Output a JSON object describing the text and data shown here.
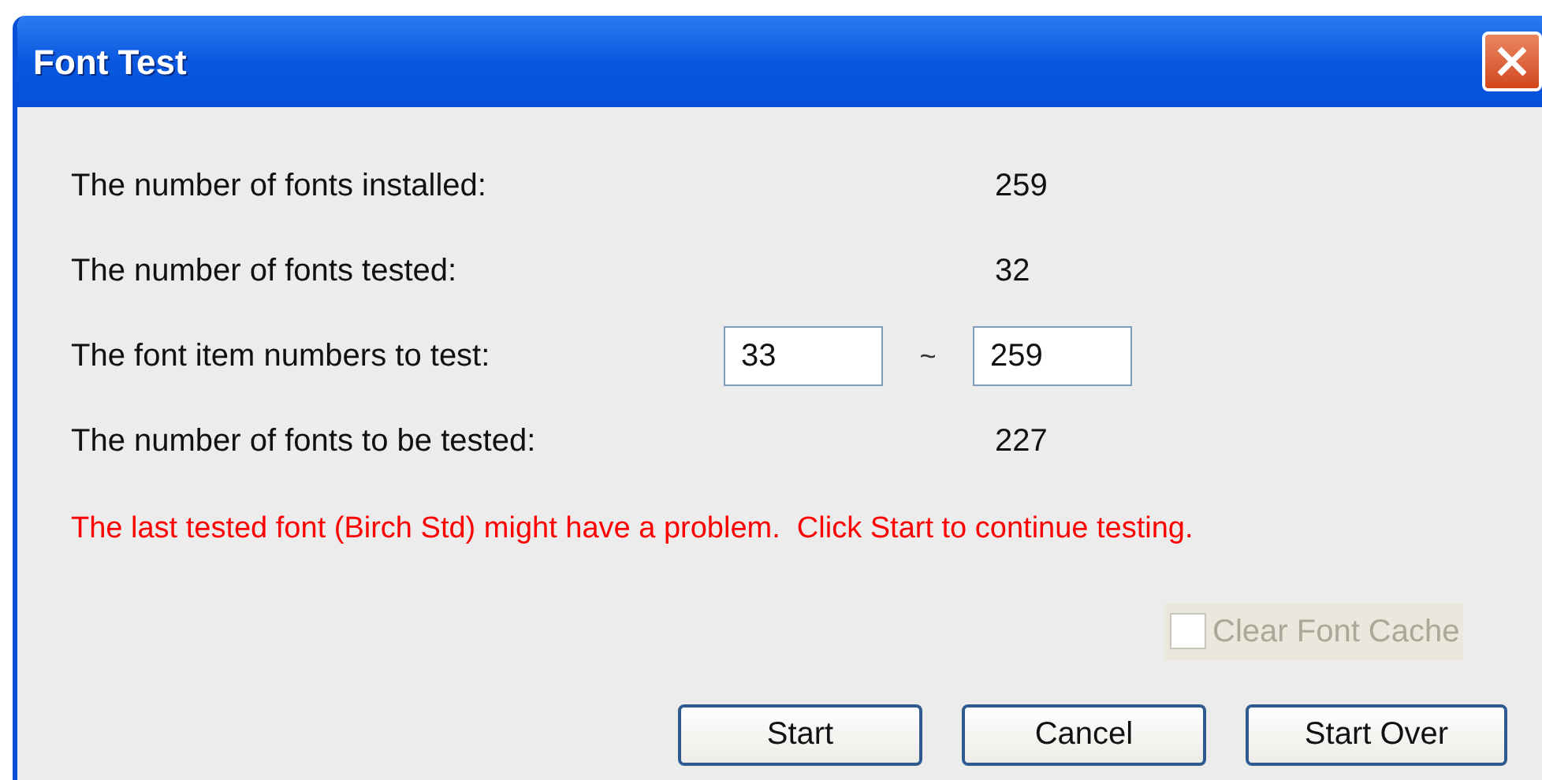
{
  "window": {
    "title": "Font Test"
  },
  "rows": [
    {
      "label": "The number of fonts installed:",
      "kind": "value",
      "value": "259"
    },
    {
      "label": "The number of fonts tested:",
      "kind": "value",
      "value": "32"
    },
    {
      "label": "The font item numbers to test:",
      "kind": "range",
      "from": "33",
      "separator": "~",
      "to": "259"
    },
    {
      "label": "The number of fonts to be tested:",
      "kind": "value",
      "value": "227"
    }
  ],
  "message": "The last tested font (Birch Std) might have a problem.  Click Start to continue testing.",
  "clear_font_cache": {
    "label": "Clear Font Cache",
    "checked": false,
    "disabled": true
  },
  "buttons": [
    "Start",
    "Cancel",
    "Start Over"
  ]
}
